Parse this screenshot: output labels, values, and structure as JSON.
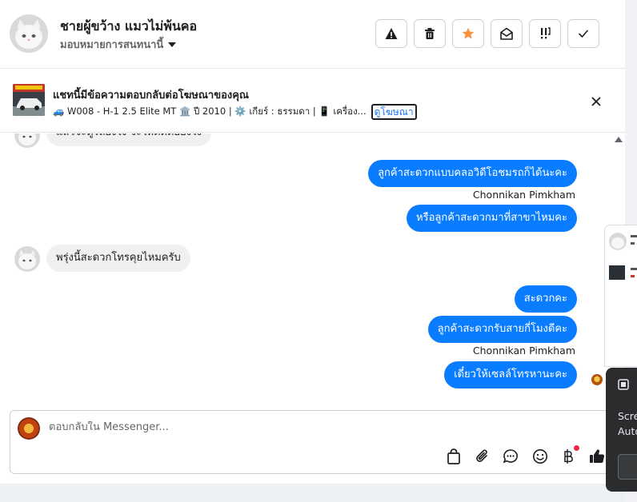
{
  "header": {
    "contact_name": "ชายผู้ขว้าง แมวไม่พ้นคอ",
    "assign_label": "มอบหมายการสนทนานี้",
    "actions": [
      {
        "icon": "warning-icon",
        "label": "spam"
      },
      {
        "icon": "trash-icon",
        "label": "delete"
      },
      {
        "icon": "star-icon",
        "label": "star"
      },
      {
        "icon": "mail-open-icon",
        "label": "mark unread"
      },
      {
        "icon": "follow-up-icon",
        "label": "follow up"
      },
      {
        "icon": "check-icon",
        "label": "done"
      }
    ],
    "star_color": "#f7923a"
  },
  "ad": {
    "title": "แชทนี้มีข้อความตอบกลับต่อโฆษณาของคุณ",
    "meta": "🚙 W008 - H-1 2.5 Elite MT 🏛️ ปี 2010 | ⚙️ เกียร์ : ธรรมดา | 📱 เครื่อง...",
    "link_label": "ดูโฆษณา"
  },
  "messages": {
    "partial_top": "แล้วจะดูรถยังไง จะให้ติดต่อยังไง",
    "out_1": "ลูกค้าสะดวกแบบคลอวิดีโอชมรถก็ได้นะคะ",
    "sender_1": "Chonnikan Pimkham",
    "out_2": "หรือลูกค้าสะดวกมาที่สาขาไหมคะ",
    "in_1": "พรุ่งนี้สะดวกโทรคุยไหมครับ",
    "out_3": "สะดวกคะ",
    "out_4": "ลูกค้าสะดวกรับสายกี่โมงดีคะ",
    "sender_2": "Chonnikan Pimkham",
    "out_5": "เดี๋ยวให้เซลล์โทรหานะคะ"
  },
  "composer": {
    "placeholder": "ตอบกลับใน Messenger...",
    "tools": [
      "bag-icon",
      "paperclip-icon",
      "chat-bubble-icon",
      "emoji-icon",
      "baht-icon",
      "thumbs-up-icon"
    ]
  },
  "toast": {
    "line_1": "Scre",
    "line_2": "Auto"
  },
  "colors": {
    "outgoing_bubble": "#0a7cff",
    "incoming_bubble": "#f0f0f0",
    "link": "#1877f2"
  }
}
